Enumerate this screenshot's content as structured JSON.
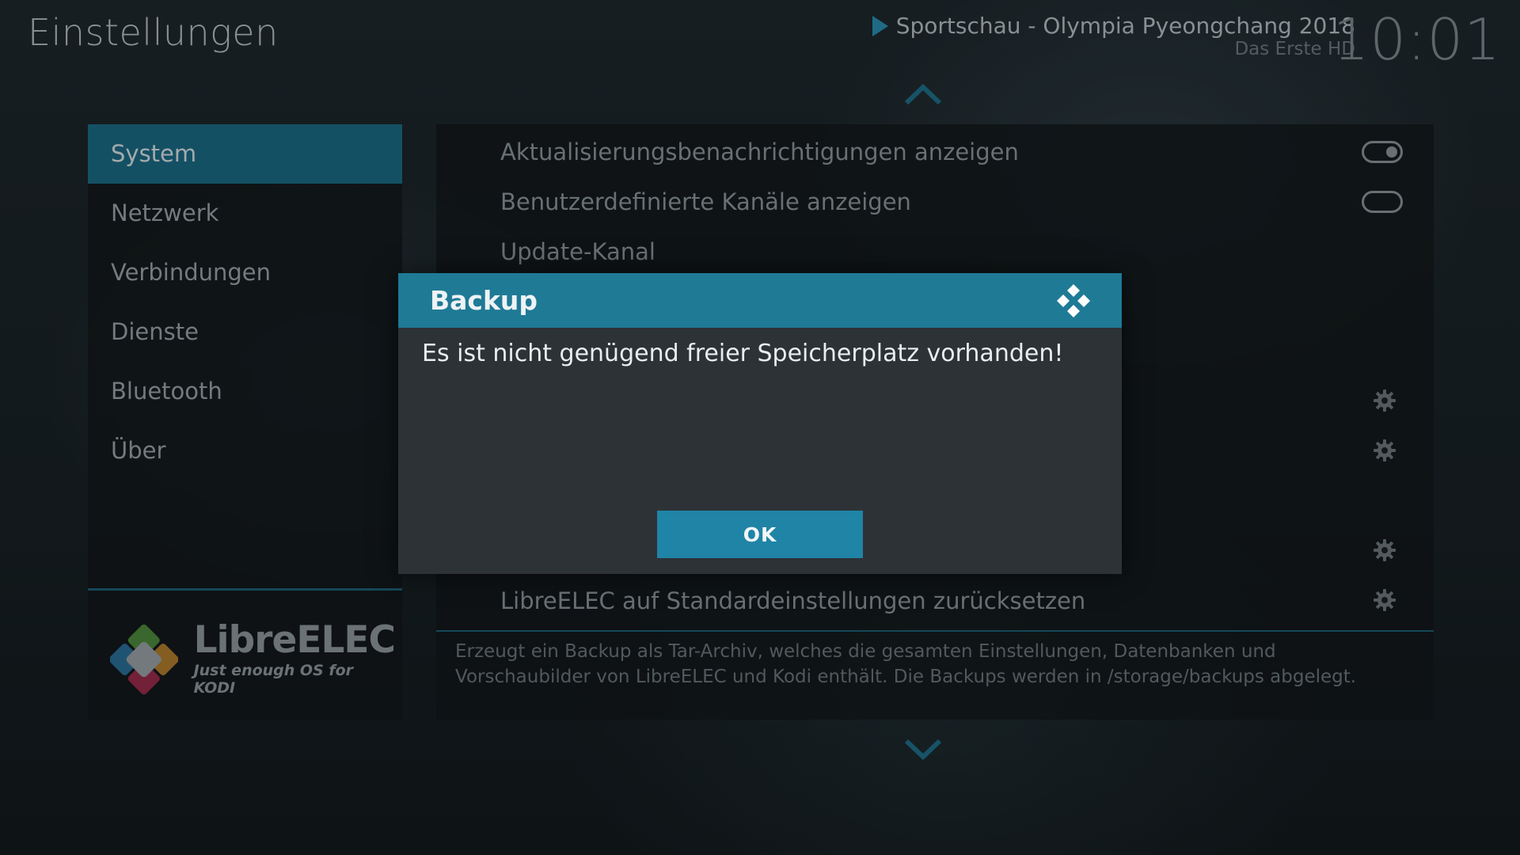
{
  "header": {
    "title": "Einstellungen",
    "now_playing_title": "Sportschau - Olympia Pyeongchang 2018",
    "now_playing_channel": "Das Erste HD",
    "clock": "10:01"
  },
  "sidebar": {
    "items": [
      {
        "label": "System",
        "active": true
      },
      {
        "label": "Netzwerk"
      },
      {
        "label": "Verbindungen"
      },
      {
        "label": "Dienste"
      },
      {
        "label": "Bluetooth"
      },
      {
        "label": "Über"
      }
    ],
    "logo_name": "LibreELEC",
    "logo_tagline": "Just enough OS for KODI"
  },
  "settings": {
    "rows": [
      {
        "label": "Aktualisierungsbenachrichtigungen anzeigen",
        "control": "toggle",
        "value": "on"
      },
      {
        "label": "Benutzerdefinierte Kanäle anzeigen",
        "control": "toggle",
        "value": "off"
      },
      {
        "label": "Update-Kanal"
      },
      {
        "label": "LibreELEC auf Standardeinstellungen zurücksetzen",
        "control": "gear"
      }
    ],
    "description": "Erzeugt ein Backup als Tar-Archiv, welches die gesamten Einstellungen, Datenbanken und Vorschaubilder von LibreELEC und Kodi enthält. Die Backups werden in /storage/backups abgelegt."
  },
  "dialog": {
    "title": "Backup",
    "message": "Es ist nicht genügend freier Speicherplatz vorhanden!",
    "ok_label": "OK"
  },
  "colors": {
    "accent": "#1f84a6",
    "active_item": "#1b6b86",
    "dialog_header": "#1f7a96"
  }
}
